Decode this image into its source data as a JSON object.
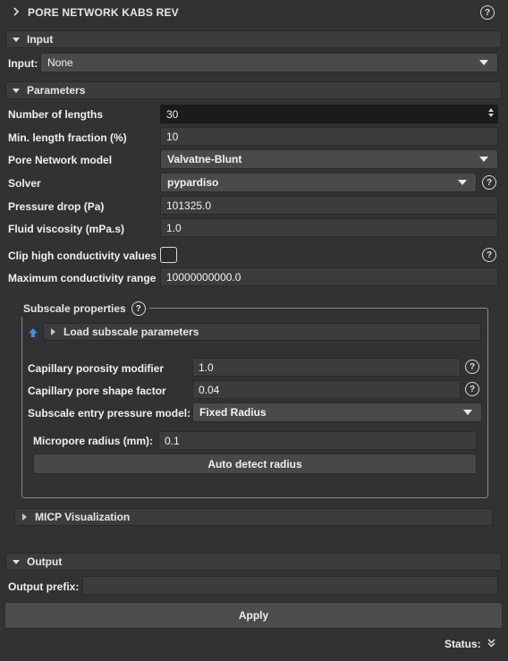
{
  "title": "PORE NETWORK KABS REV",
  "sections": {
    "input": "Input",
    "parameters": "Parameters",
    "output": "Output"
  },
  "input": {
    "label": "Input:",
    "value": "None"
  },
  "parameters": {
    "number_of_lengths": {
      "label": "Number of lengths",
      "value": "30"
    },
    "min_length_fraction": {
      "label": "Min. length fraction (%)",
      "value": "10"
    },
    "pore_network_model": {
      "label": "Pore Network model",
      "value": "Valvatne-Blunt"
    },
    "solver": {
      "label": "Solver",
      "value": "pypardiso"
    },
    "pressure_drop": {
      "label": "Pressure drop (Pa)",
      "value": "101325.0"
    },
    "fluid_viscosity": {
      "label": "Fluid viscosity (mPa.s)",
      "value": "1.0"
    },
    "clip_high_conductivity": {
      "label": "Clip high conductivity values",
      "checked": false
    },
    "max_conductivity_range": {
      "label": "Maximum conductivity range",
      "value": "10000000000.0"
    }
  },
  "subscale": {
    "title": "Subscale properties",
    "load_label": "Load subscale parameters",
    "capillary_porosity_modifier": {
      "label": "Capillary porosity modifier",
      "value": "1.0"
    },
    "capillary_pore_shape_factor": {
      "label": "Capillary pore shape factor",
      "value": "0.04"
    },
    "entry_pressure_model": {
      "label": "Subscale entry pressure model:",
      "value": "Fixed Radius"
    },
    "micropore_radius": {
      "label": "Micropore radius (mm):",
      "value": "0.1"
    },
    "auto_detect_label": "Auto detect radius"
  },
  "micp": {
    "label": "MICP Visualization"
  },
  "output": {
    "prefix_label": "Output prefix:",
    "prefix_value": ""
  },
  "apply_label": "Apply",
  "status_label": "Status:",
  "help_glyph": "?",
  "colors": {
    "background": "#323232",
    "header": "#3c3c3c",
    "field": "#3c3c3c",
    "dark_field": "#1b1b1b",
    "upload_icon": "#3a8fe8"
  }
}
